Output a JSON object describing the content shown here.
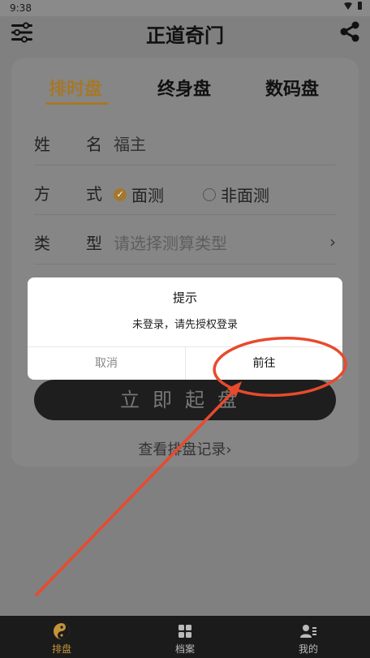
{
  "status_bar": {
    "time": "9:38",
    "wifi_icon": "wifi-icon",
    "battery_icon": "battery-icon"
  },
  "header": {
    "title": "正道奇门",
    "menu_icon": "menu-icon",
    "share_icon": "share-icon"
  },
  "tabs": [
    {
      "label": "排时盘",
      "active": true
    },
    {
      "label": "终身盘",
      "active": false
    },
    {
      "label": "数码盘",
      "active": false
    }
  ],
  "form": {
    "name": {
      "label_1": "姓",
      "label_2": "名",
      "value": "福主"
    },
    "method": {
      "label_1": "方",
      "label_2": "式",
      "options": [
        {
          "label": "面测",
          "selected": true
        },
        {
          "label": "非面测",
          "selected": false
        }
      ]
    },
    "type": {
      "label_1": "类",
      "label_2": "型",
      "placeholder": "请选择测算类型",
      "chevron": "›"
    }
  },
  "start_button": "立即起盘",
  "history_link": "查看排盘记录›",
  "dialog": {
    "title": "提示",
    "message": "未登录，请先授权登录",
    "cancel": "取消",
    "confirm": "前往"
  },
  "tabbar": [
    {
      "label": "排盘",
      "icon": "yin-yang-icon",
      "active": true
    },
    {
      "label": "档案",
      "icon": "grid-icon",
      "active": false
    },
    {
      "label": "我的",
      "icon": "user-icon",
      "active": false
    }
  ],
  "colors": {
    "accent": "#a4782c",
    "annotation": "#e84a2e",
    "overlay": "#808080",
    "tabbar": "#1b1b1b"
  }
}
